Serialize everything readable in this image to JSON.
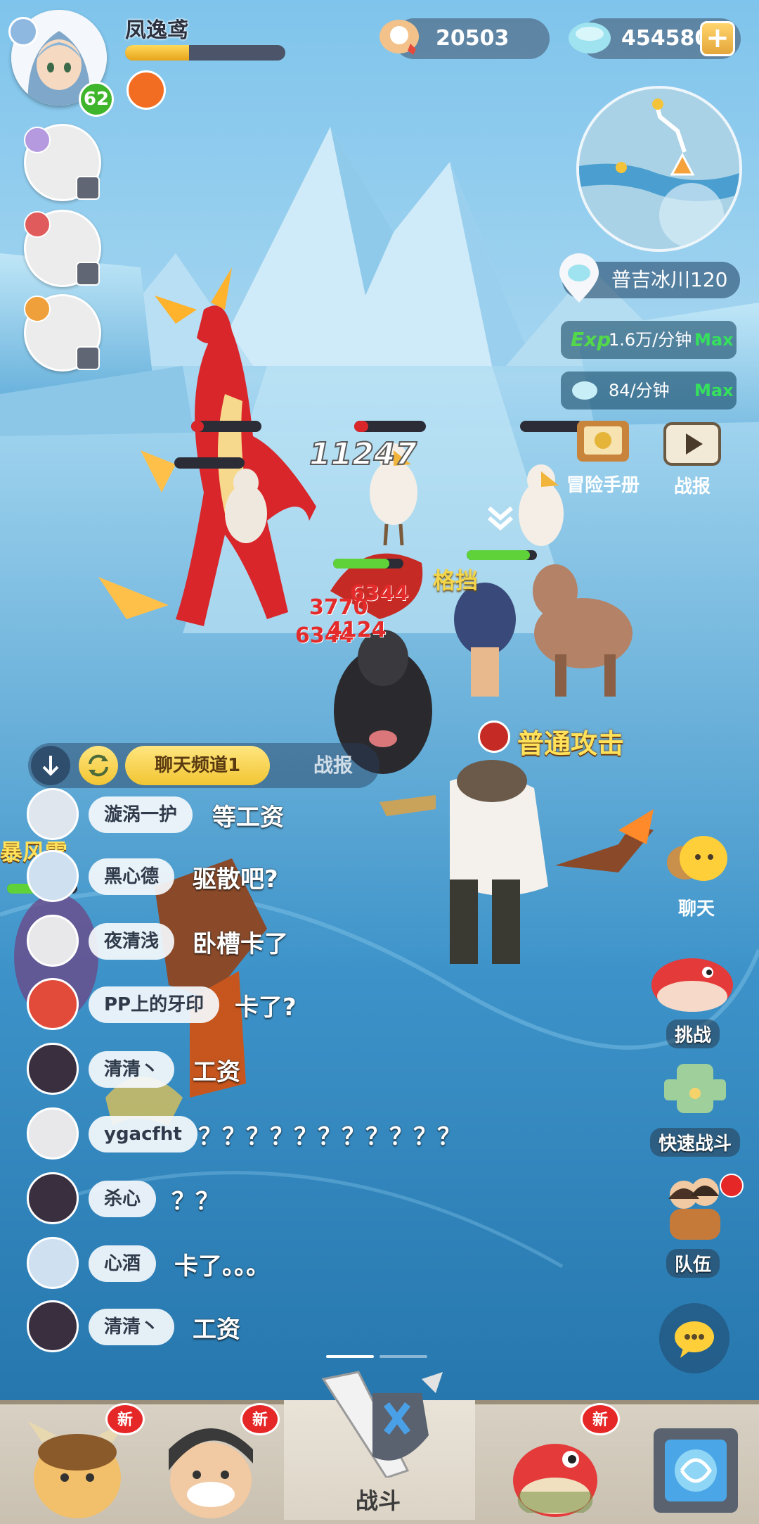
{
  "player": {
    "name": "凤逸鸢",
    "level": "62",
    "hp_fraction": 0.4
  },
  "currency": {
    "pearls": "20503",
    "gems": "454580",
    "add_symbol": "+"
  },
  "location": {
    "name": "普吉冰川120"
  },
  "stats": {
    "exp_prefix": "Exp",
    "exp_rate": "1.6万/分钟",
    "exp_max": "Max",
    "gem_rate": "84/分钟",
    "gem_max": "Max"
  },
  "side_buttons": {
    "adventure_manual": "冒险手册",
    "battle_report": "战报",
    "chat": "聊天",
    "challenge": "挑战",
    "quick_battle": "快速战斗",
    "team": "队伍"
  },
  "battle": {
    "big_damage": "11247",
    "block_text": "格挡",
    "skill_name": "普通攻击",
    "damage_numbers": [
      "6344",
      "3770",
      "6344",
      "4124"
    ],
    "ally_label": "暴风雷"
  },
  "chat": {
    "tab_active": "聊天频道1",
    "tab_inactive": "战报",
    "messages": [
      {
        "name": "漩涡一护",
        "text": "等工资"
      },
      {
        "name": "黑心德",
        "text": "驱散吧?"
      },
      {
        "name": "夜清浅",
        "text": "卧槽卡了"
      },
      {
        "name": "PP上的牙印",
        "text": "卡了?"
      },
      {
        "name": "清清丶",
        "text": "工资"
      },
      {
        "name": "ygacfht",
        "text": "？？？？？？？？？？？"
      },
      {
        "name": "杀心",
        "text": "？？"
      },
      {
        "name": "心酒",
        "text": "卡了。。。"
      },
      {
        "name": "清清丶",
        "text": "工资"
      }
    ]
  },
  "bottom_nav": {
    "new_label": "新",
    "center_label": "战斗"
  },
  "colors": {
    "accent_gold": "#f2c532",
    "hp_green": "#3fb52b",
    "max_green": "#35e05d",
    "badge_red": "#e62727"
  }
}
